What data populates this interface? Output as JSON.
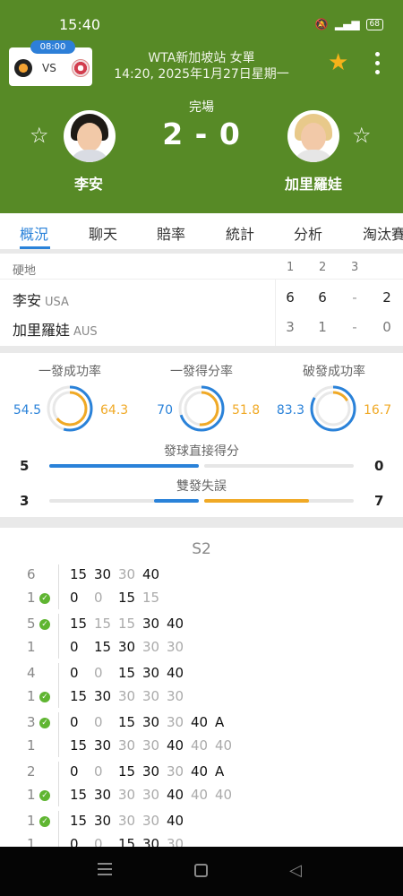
{
  "status_bar": {
    "time": "15:40",
    "battery": "68"
  },
  "header": {
    "mini_time": "08:00",
    "mini_vs": "VS",
    "event_name": "WTA新加坡站 女單",
    "event_datetime": "14:20, 2025年1月27日星期一",
    "match_status": "完場",
    "score": "2 - 0",
    "player1": {
      "name": "李安"
    },
    "player2": {
      "name": "加里羅娃"
    }
  },
  "tabs": [
    "概況",
    "聊天",
    "賠率",
    "統計",
    "分析",
    "淘汰賽"
  ],
  "scoreboard": {
    "surface": "硬地",
    "set_headers": [
      "1",
      "2",
      "3"
    ],
    "rows": [
      {
        "name": "李安",
        "country": "USA",
        "sets": [
          "6",
          "6",
          "-"
        ],
        "total": "2"
      },
      {
        "name": "加里羅娃",
        "country": "AUS",
        "sets": [
          "3",
          "1",
          "-"
        ],
        "total": "0"
      }
    ]
  },
  "stats": {
    "rings": [
      {
        "title": "一發成功率",
        "left": "54.5",
        "right": "64.3"
      },
      {
        "title": "一發得分率",
        "left": "70",
        "right": "51.8"
      },
      {
        "title": "破發成功率",
        "left": "83.3",
        "right": "16.7"
      }
    ],
    "bars": [
      {
        "title": "發球直接得分",
        "left": "5",
        "right": "0"
      },
      {
        "title": "雙發失誤",
        "left": "3",
        "right": "7"
      }
    ],
    "colors": {
      "player1": "#2a82d9",
      "player2": "#f0a925"
    }
  },
  "points": {
    "set_label": "S2",
    "games": [
      {
        "top_label": "6",
        "bottom_label": "1",
        "check": "bottom",
        "top": [
          "15",
          "30",
          "30",
          "40"
        ],
        "bottom": [
          "0",
          "0",
          "15",
          "15"
        ]
      },
      {
        "top_label": "5",
        "bottom_label": "1",
        "check": "top",
        "top": [
          "15",
          "15",
          "15",
          "30",
          "40"
        ],
        "bottom": [
          "0",
          "15",
          "30",
          "30",
          "30"
        ]
      },
      {
        "top_label": "4",
        "bottom_label": "1",
        "check": "bottom",
        "top": [
          "0",
          "0",
          "15",
          "30",
          "40"
        ],
        "bottom": [
          "15",
          "30",
          "30",
          "30",
          "30"
        ]
      },
      {
        "top_label": "3",
        "bottom_label": "1",
        "check": "top",
        "top": [
          "0",
          "0",
          "15",
          "30",
          "30",
          "40",
          "A"
        ],
        "bottom": [
          "15",
          "30",
          "30",
          "30",
          "40",
          "40",
          "40"
        ]
      },
      {
        "top_label": "2",
        "bottom_label": "1",
        "check": "bottom",
        "top": [
          "0",
          "0",
          "15",
          "30",
          "30",
          "40",
          "A"
        ],
        "bottom": [
          "15",
          "30",
          "30",
          "30",
          "40",
          "40",
          "40"
        ]
      },
      {
        "top_label": "1",
        "bottom_label": "1",
        "check": "top",
        "top": [
          "15",
          "30",
          "30",
          "30",
          "40"
        ],
        "bottom": [
          "0",
          "0",
          "15",
          "30",
          "30"
        ]
      }
    ]
  }
}
